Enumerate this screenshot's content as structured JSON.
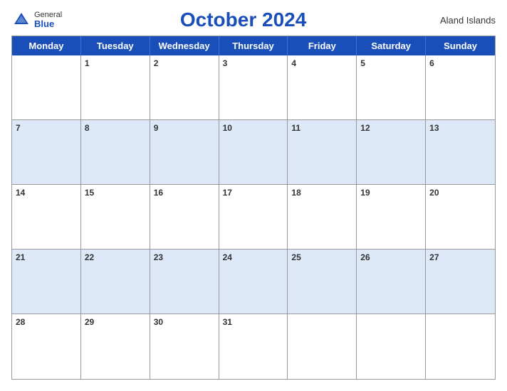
{
  "header": {
    "logo_general": "General",
    "logo_blue": "Blue",
    "title": "October 2024",
    "region": "Aland Islands"
  },
  "calendar": {
    "days_of_week": [
      "Monday",
      "Tuesday",
      "Wednesday",
      "Thursday",
      "Friday",
      "Saturday",
      "Sunday"
    ],
    "weeks": [
      [
        {
          "date": "",
          "shaded": false
        },
        {
          "date": "1",
          "shaded": false
        },
        {
          "date": "2",
          "shaded": false
        },
        {
          "date": "3",
          "shaded": false
        },
        {
          "date": "4",
          "shaded": false
        },
        {
          "date": "5",
          "shaded": false
        },
        {
          "date": "6",
          "shaded": false
        }
      ],
      [
        {
          "date": "7",
          "shaded": true
        },
        {
          "date": "8",
          "shaded": true
        },
        {
          "date": "9",
          "shaded": true
        },
        {
          "date": "10",
          "shaded": true
        },
        {
          "date": "11",
          "shaded": true
        },
        {
          "date": "12",
          "shaded": true
        },
        {
          "date": "13",
          "shaded": true
        }
      ],
      [
        {
          "date": "14",
          "shaded": false
        },
        {
          "date": "15",
          "shaded": false
        },
        {
          "date": "16",
          "shaded": false
        },
        {
          "date": "17",
          "shaded": false
        },
        {
          "date": "18",
          "shaded": false
        },
        {
          "date": "19",
          "shaded": false
        },
        {
          "date": "20",
          "shaded": false
        }
      ],
      [
        {
          "date": "21",
          "shaded": true
        },
        {
          "date": "22",
          "shaded": true
        },
        {
          "date": "23",
          "shaded": true
        },
        {
          "date": "24",
          "shaded": true
        },
        {
          "date": "25",
          "shaded": true
        },
        {
          "date": "26",
          "shaded": true
        },
        {
          "date": "27",
          "shaded": true
        }
      ],
      [
        {
          "date": "28",
          "shaded": false
        },
        {
          "date": "29",
          "shaded": false
        },
        {
          "date": "30",
          "shaded": false
        },
        {
          "date": "31",
          "shaded": false
        },
        {
          "date": "",
          "shaded": false
        },
        {
          "date": "",
          "shaded": false
        },
        {
          "date": "",
          "shaded": false
        }
      ]
    ]
  }
}
